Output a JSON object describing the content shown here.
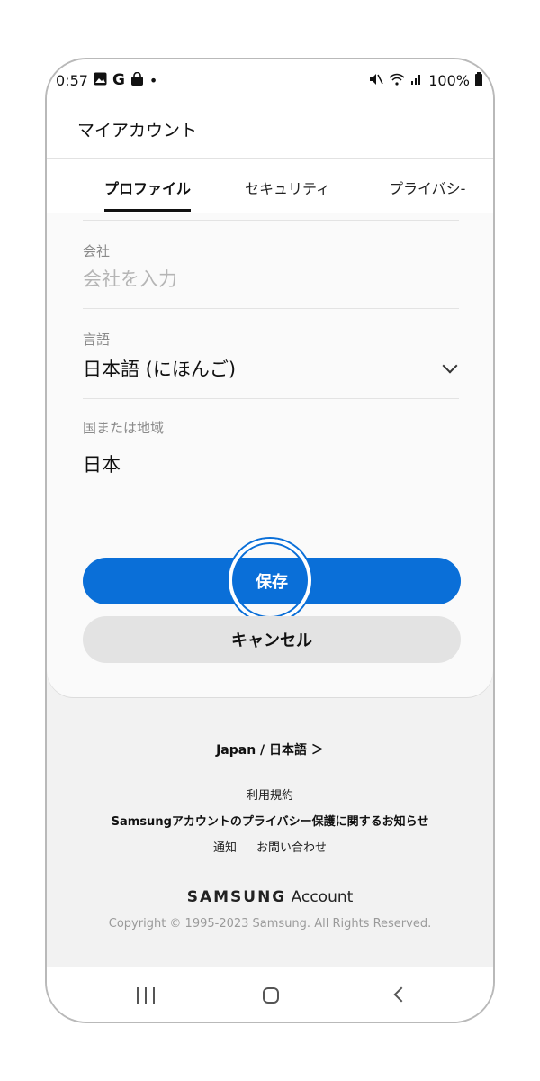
{
  "status_bar": {
    "time": "0:57",
    "g_letter": "G",
    "dot": "•",
    "battery": "100%",
    "icons": [
      "image-icon",
      "google-icon",
      "shopping-bag-icon",
      "dot-icon",
      "mute-icon",
      "wifi-icon",
      "signal-icon",
      "battery-icon"
    ]
  },
  "app_bar": {
    "title": "マイアカウント"
  },
  "tabs": [
    {
      "label": "プロファイル",
      "active": true
    },
    {
      "label": "セキュリティ",
      "active": false
    },
    {
      "label": "プライバシ-",
      "active": false
    }
  ],
  "form": {
    "company": {
      "label": "会社",
      "placeholder": "会社を入力"
    },
    "language": {
      "label": "言語",
      "value": "日本語 (にほんご)"
    },
    "region": {
      "label": "国または地域",
      "value": "日本"
    }
  },
  "buttons": {
    "save": "保存",
    "cancel": "キャンセル"
  },
  "footer": {
    "locale": "Japan / 日本語 ＞",
    "terms": "利用規約",
    "privacy": "Samsungアカウントのプライバシー保護に関するお知らせ",
    "notice": "通知",
    "contact": "お問い合わせ",
    "brand_word": "SAMSUNG",
    "brand_suffix": "Account",
    "copyright": "Copyright © 1995-2023 Samsung. All Rights Reserved."
  },
  "colors": {
    "accent": "#0a6fd8",
    "cancel_bg": "#e3e3e3",
    "page_bg": "#f2f2f2"
  }
}
